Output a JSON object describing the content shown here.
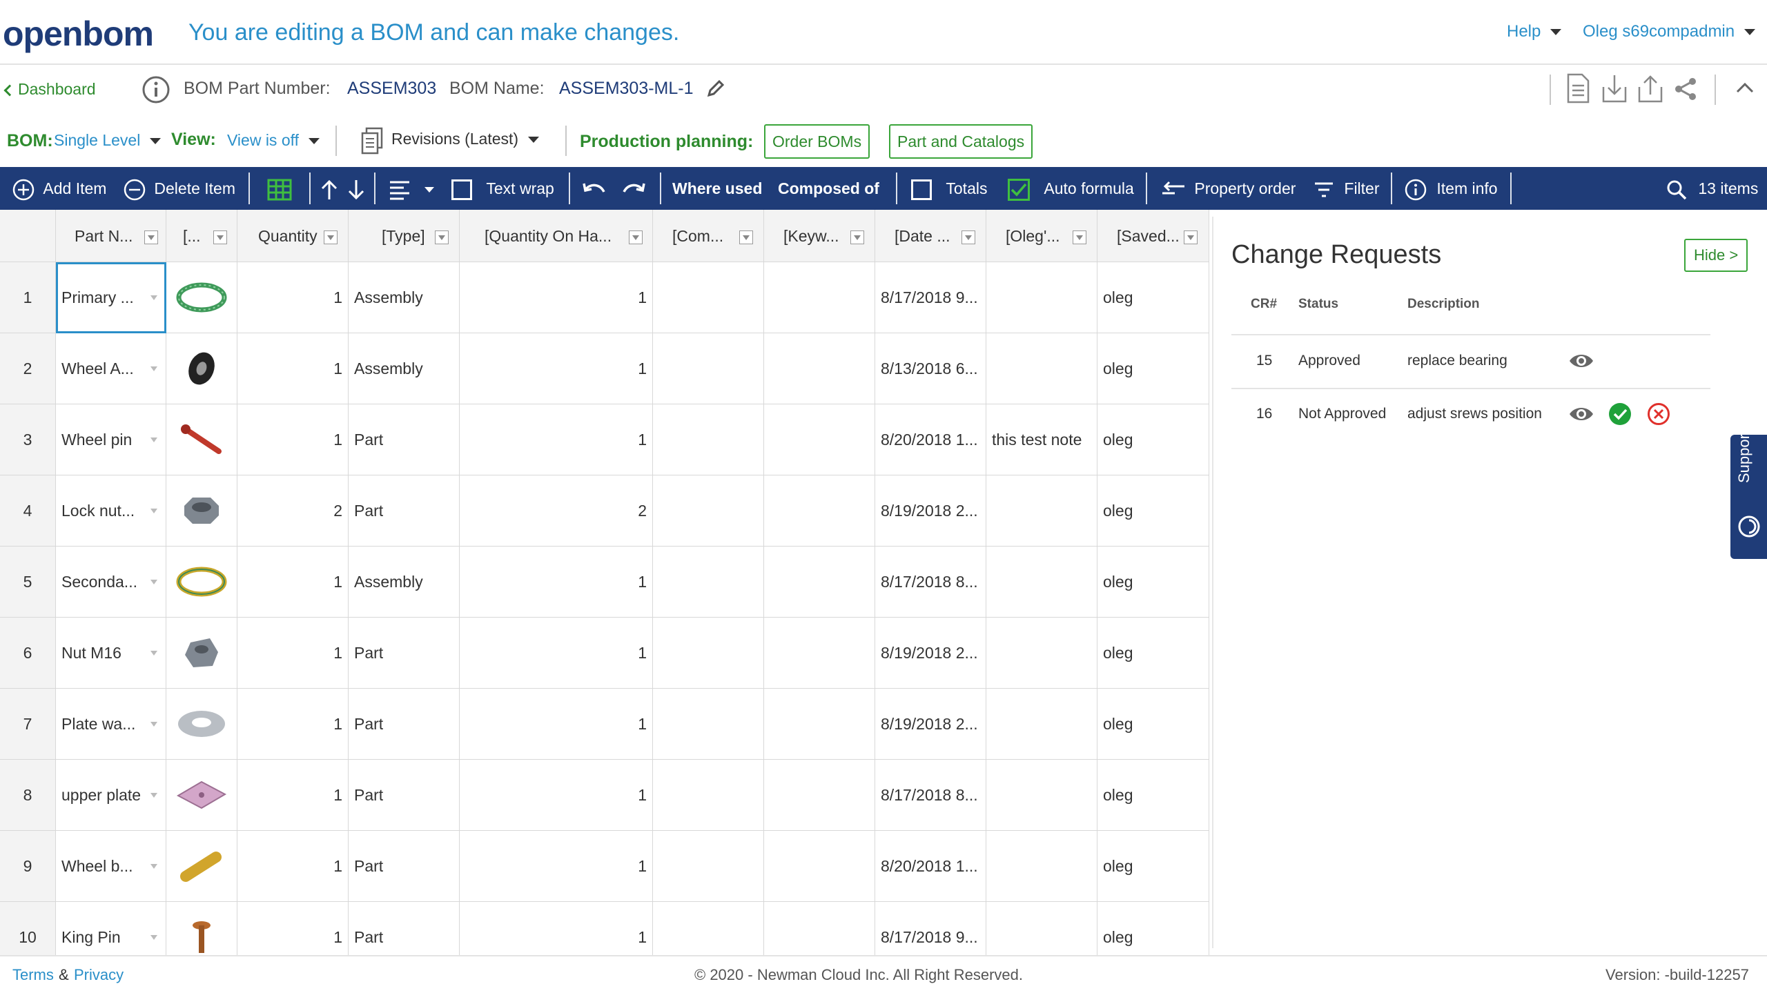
{
  "header": {
    "logo": "openbom",
    "editing_message": "You are editing a BOM and can make changes.",
    "help_label": "Help",
    "user_label": "Oleg s69compadmin"
  },
  "bom_info": {
    "dashboard_label": "Dashboard",
    "part_number_label": "BOM Part Number:",
    "part_number_value": "ASSEM303",
    "bom_name_label": "BOM Name:",
    "bom_name_value": "ASSEM303-ML-1"
  },
  "controls": {
    "bom_label": "BOM:",
    "bom_level": "Single Level",
    "view_label": "View:",
    "view_value": "View is off",
    "revisions_label": "Revisions (Latest)",
    "production_label": "Production planning:",
    "order_boms_label": "Order BOMs",
    "part_catalogs_label": "Part and Catalogs"
  },
  "toolbar": {
    "add_item": "Add Item",
    "delete_item": "Delete Item",
    "text_wrap": "Text wrap",
    "where_used": "Where used",
    "composed_of": "Composed of",
    "totals": "Totals",
    "auto_formula": "Auto formula",
    "property_order": "Property order",
    "filter": "Filter",
    "item_info": "Item info",
    "items_count": "13 items"
  },
  "grid": {
    "columns": [
      "Part N...",
      "[...",
      "Quantity",
      "[Type]",
      "[Quantity On Ha...",
      "[Com...",
      "[Keyw...",
      "[Date ...",
      "[Oleg'...",
      "[Saved..."
    ],
    "rows": [
      {
        "num": "1",
        "part": "Primary ...",
        "qty": "1",
        "type": "Assembly",
        "qoh": "1",
        "date": "8/17/2018 9...",
        "note": "",
        "saved": "oleg",
        "thumb": "green-ring"
      },
      {
        "num": "2",
        "part": "Wheel A...",
        "qty": "1",
        "type": "Assembly",
        "qoh": "1",
        "date": "8/13/2018 6...",
        "note": "",
        "saved": "oleg",
        "thumb": "wheel"
      },
      {
        "num": "3",
        "part": "Wheel pin",
        "qty": "1",
        "type": "Part",
        "qoh": "1",
        "date": "8/20/2018 1...",
        "note": "this test note",
        "saved": "oleg",
        "thumb": "pin"
      },
      {
        "num": "4",
        "part": "Lock nut...",
        "qty": "2",
        "type": "Part",
        "qoh": "2",
        "date": "8/19/2018 2...",
        "note": "",
        "saved": "oleg",
        "thumb": "locknut"
      },
      {
        "num": "5",
        "part": "Seconda...",
        "qty": "1",
        "type": "Assembly",
        "qoh": "1",
        "date": "8/17/2018 8...",
        "note": "",
        "saved": "oleg",
        "thumb": "yellow-ring"
      },
      {
        "num": "6",
        "part": "Nut M16",
        "qty": "1",
        "type": "Part",
        "qoh": "1",
        "date": "8/19/2018 2...",
        "note": "",
        "saved": "oleg",
        "thumb": "nut"
      },
      {
        "num": "7",
        "part": "Plate wa...",
        "qty": "1",
        "type": "Part",
        "qoh": "1",
        "date": "8/19/2018 2...",
        "note": "",
        "saved": "oleg",
        "thumb": "washer"
      },
      {
        "num": "8",
        "part": "upper plate",
        "qty": "1",
        "type": "Part",
        "qoh": "1",
        "date": "8/17/2018 8...",
        "note": "",
        "saved": "oleg",
        "thumb": "plate"
      },
      {
        "num": "9",
        "part": "Wheel b...",
        "qty": "1",
        "type": "Part",
        "qoh": "1",
        "date": "8/20/2018 1...",
        "note": "",
        "saved": "oleg",
        "thumb": "bushing"
      },
      {
        "num": "10",
        "part": "King Pin",
        "qty": "1",
        "type": "Part",
        "qoh": "1",
        "date": "8/17/2018 9...",
        "note": "",
        "saved": "oleg",
        "thumb": "kingpin"
      }
    ]
  },
  "change_requests": {
    "title": "Change Requests",
    "hide_label": "Hide >",
    "headers": {
      "cr": "CR#",
      "status": "Status",
      "description": "Description"
    },
    "items": [
      {
        "cr": "15",
        "status": "Approved",
        "description": "replace bearing"
      },
      {
        "cr": "16",
        "status": "Not Approved",
        "description": "adjust srews position"
      }
    ]
  },
  "support_label": "Support",
  "footer": {
    "terms": "Terms",
    "amp": "&",
    "privacy": "Privacy",
    "copyright": "© 2020 - Newman Cloud Inc. All Right Reserved.",
    "version": "Version: -build-12257"
  },
  "colors": {
    "brand_navy": "#1f3c78",
    "link_blue": "#2a8fc9",
    "accent_green": "#2e8b2e",
    "reject_red": "#e0302b"
  }
}
